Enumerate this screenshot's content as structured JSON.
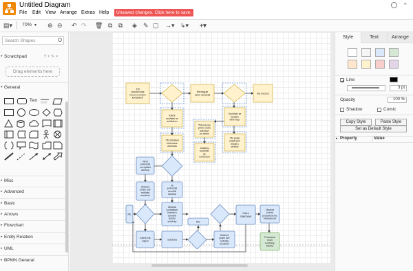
{
  "app": {
    "title": "Untitled Diagram",
    "unsaved_notice": "Unsaved changes. Click here to save."
  },
  "menu": [
    "File",
    "Edit",
    "View",
    "Arrange",
    "Extras",
    "Help"
  ],
  "toolbar": {
    "zoom": "70%"
  },
  "sidebar": {
    "search_placeholder": "Search Shapes",
    "scratchpad": "Scratchpad",
    "scratchpad_icons": "? + ✎ ×",
    "drag_hint": "Drag elements here",
    "sections": [
      "General",
      "Misc",
      "Advanced",
      "Basic",
      "Arrows",
      "Flowchart",
      "Entity Relation",
      "UML",
      "BPMN General"
    ],
    "shape_text_label": "Text"
  },
  "format_panel": {
    "tabs": [
      "Style",
      "Text",
      "Arrange"
    ],
    "line_label": "Line",
    "line_width": "3 pt",
    "opacity_label": "Opacity",
    "opacity_value": "100 %",
    "shadow_label": "Shadow",
    "comic_label": "Comic",
    "copy_style": "Copy Style",
    "paste_style": "Paste Style",
    "set_default": "Set as Default Style",
    "property_col": "Property",
    "value_col": "Value",
    "swatches": [
      "#ffffff",
      "#f5f5f5",
      "#dae8fc",
      "#d5e8d4",
      "#ffe6cc",
      "#fff2cc",
      "#f8cecc",
      "#e1d5e7"
    ]
  },
  "diagram": {
    "colors": {
      "yellow_fill": "#fff2cc",
      "yellow_stroke": "#d6b656",
      "blue_fill": "#dae8fc",
      "blue_stroke": "#6c8ebf",
      "green_fill": "#d5e8d4",
      "green_stroke": "#82b366"
    },
    "labels": {
      "n1": "TM uskutečňuje hovor s novým kontaktem",
      "n2": "Nereaguje nebo nezvedá",
      "n3": "Nic nechce",
      "n4": "Klient souhlasí se schůzkou",
      "n5": "Souhlasí se zaslání informací",
      "n6": "TM pracuje přímo nebo klientovi po týdnu",
      "n7": "TM předává informace obchodu",
      "n8": "TM pošle zaslanými email s přílohy",
      "n9": "Zaslaný souhlasí se schůzkou",
      "n10": "Není potenciál na výklad obchod",
      "n11": "Je potenciál na větší obchod",
      "n12": "Obchod pošle své nabídky emailem",
      "n13": "Obchod kontaktuje klienta a domluví termín schůzky",
      "n14": "NE",
      "n15": "NIC",
      "n16": "Klient objednává",
      "n17": "Obchod předá projektovému manažerovi",
      "n18": "Klient má zájem",
      "n19": "Schůzka",
      "n20": "Obchod pošle své nabídky emailem",
      "n21": "Proudová mezi kontakty klienta"
    }
  }
}
